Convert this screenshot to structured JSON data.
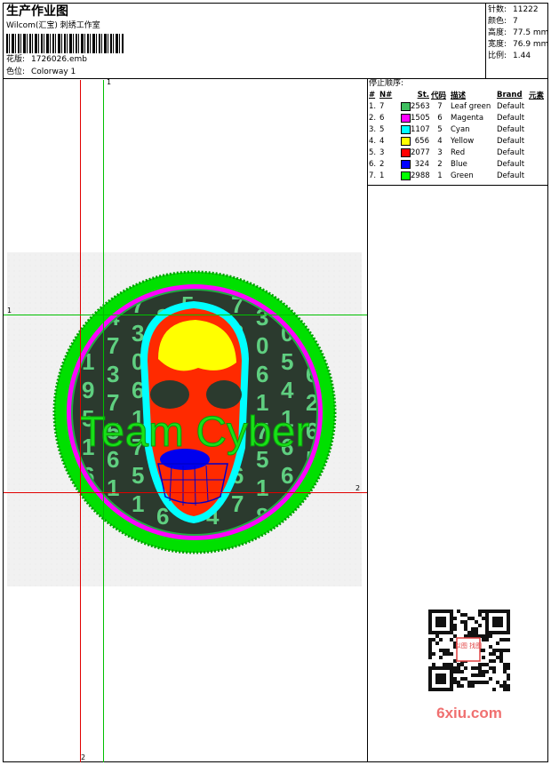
{
  "header": {
    "title": "生产作业图",
    "company": "Wilcom(汇宝) 刺绣工作室",
    "design_file_label": "花版:",
    "design_file": "1726026.emb",
    "colorway_label": "色位:",
    "colorway": "Colorway 1"
  },
  "stats": {
    "stitches_label": "针数:",
    "stitches": "11222",
    "colors_label": "颜色:",
    "colors": "7",
    "height_label": "高度:",
    "height": "77.5 mm",
    "width_label": "宽度:",
    "width": "76.9 mm",
    "ratio_label": "比例:",
    "ratio": "1.44"
  },
  "color_sequence": {
    "heading": "停止顺序:",
    "columns": [
      "#",
      "N#",
      "St.",
      "代码",
      "描述",
      "Brand",
      "元素"
    ],
    "rows": [
      {
        "index": "1.",
        "n": "7",
        "st": "2563",
        "code": "7",
        "desc": "Leaf green",
        "brand": "Default",
        "color": "#3fbf60"
      },
      {
        "index": "2.",
        "n": "6",
        "st": "1505",
        "code": "6",
        "desc": "Magenta",
        "brand": "Default",
        "color": "#ff00ff"
      },
      {
        "index": "3.",
        "n": "5",
        "st": "1107",
        "code": "5",
        "desc": "Cyan",
        "brand": "Default",
        "color": "#00ffff"
      },
      {
        "index": "4.",
        "n": "4",
        "st": "656",
        "code": "4",
        "desc": "Yellow",
        "brand": "Default",
        "color": "#ffff00"
      },
      {
        "index": "5.",
        "n": "3",
        "st": "2077",
        "code": "3",
        "desc": "Red",
        "brand": "Default",
        "color": "#ff0000"
      },
      {
        "index": "6.",
        "n": "2",
        "st": "324",
        "code": "2",
        "desc": "Blue",
        "brand": "Default",
        "color": "#0000ff"
      },
      {
        "index": "7.",
        "n": "1",
        "st": "2988",
        "code": "1",
        "desc": "Green",
        "brand": "Default",
        "color": "#00ff00"
      }
    ]
  },
  "design": {
    "text": "Team Cyber",
    "digits": [
      "6",
      "5",
      "1",
      "9",
      "5",
      "1",
      "6",
      "1",
      "4",
      "7",
      "3",
      "7",
      "5",
      "6",
      "1",
      "6",
      "7",
      "3",
      "0",
      "6",
      "1",
      "7",
      "5",
      "1",
      "8",
      "1",
      "0",
      "5",
      "4",
      "1",
      "6",
      "6",
      "5",
      "7",
      "5",
      "6",
      "2",
      "6",
      "5"
    ]
  },
  "guides": {
    "h1": "1",
    "h2": "2",
    "v1": "1",
    "v2": "2"
  },
  "watermark": {
    "site": "6xiu.com",
    "stamp": "以图 找图"
  }
}
